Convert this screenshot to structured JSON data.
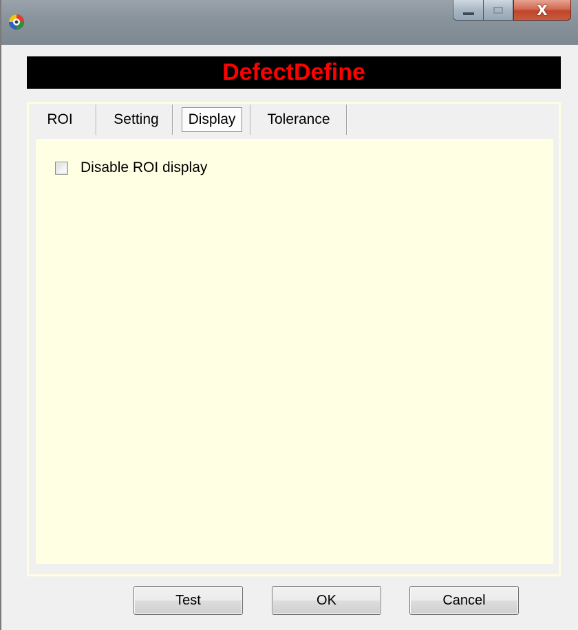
{
  "window": {
    "title": "",
    "icon": "app-globe-icon",
    "controls": {
      "minimize": "minimize-icon",
      "maximize": "maximize-icon",
      "close_glyph": "X"
    }
  },
  "header": {
    "title": "DefectDefine",
    "title_color": "#ff0000",
    "background": "#000000"
  },
  "tabs": [
    {
      "label": "ROI",
      "active": false
    },
    {
      "label": "Setting",
      "active": false
    },
    {
      "label": "Display",
      "active": true
    },
    {
      "label": "Tolerance",
      "active": false
    }
  ],
  "display_tab": {
    "background": "#ffffe3",
    "disable_roi_display": {
      "label": "Disable ROI display",
      "checked": false
    }
  },
  "buttons": {
    "test": "Test",
    "ok": "OK",
    "cancel": "Cancel"
  }
}
